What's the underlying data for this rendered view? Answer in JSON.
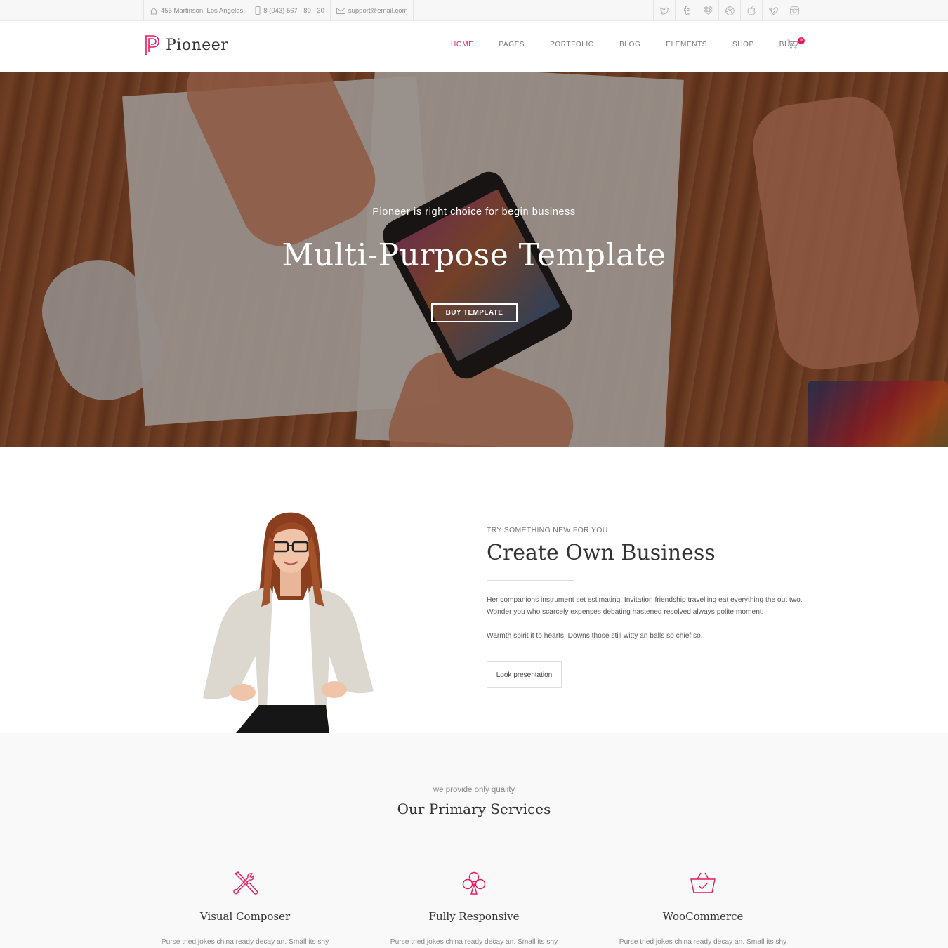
{
  "topbar": {
    "address": "455 Martinson, Los Angeles",
    "phone": "8 (043) 567 - 89 - 30",
    "email": "support@email.com",
    "social": [
      "twitter-icon",
      "tumblr-icon",
      "dropbox-icon",
      "dribbble-icon",
      "apple-icon",
      "vimeo-icon",
      "instagram-icon"
    ]
  },
  "header": {
    "logo_text": "Pioneer",
    "brand_color": "#e6195e",
    "nav": [
      "HOME",
      "PAGES",
      "PORTFOLIO",
      "BLOG",
      "ELEMENTS",
      "SHOP",
      "BUY"
    ],
    "active_nav": "HOME",
    "cart_count": "0"
  },
  "hero": {
    "subtitle": "Pioneer is right choice for begin business",
    "title": "Multi-Purpose Template",
    "button": "BUY TEMPLATE"
  },
  "about": {
    "eyebrow": "TRY SOMETHING NEW FOR YOU",
    "title": "Create Own Business",
    "paragraph1": "Her companions instrument set estimating. Invitation friendship travelling eat everything the out two. Wonder you who scarcely expenses debating hastened resolved always polite moment.",
    "paragraph2": "Warmth spirit it to hearts. Downs those still witty an balls so chief so.",
    "button": "Look presentation"
  },
  "services": {
    "eyebrow": "we provide only quality",
    "title": "Our Primary Services",
    "items": [
      {
        "icon": "tools-icon",
        "name": "Visual Composer",
        "desc": "Purse tried jokes china ready decay an. Small its shy"
      },
      {
        "icon": "club-icon",
        "name": "Fully Responsive",
        "desc": "Purse tried jokes china ready decay an. Small its shy"
      },
      {
        "icon": "basket-icon",
        "name": "WooCommerce",
        "desc": "Purse tried jokes china ready decay an. Small its shy"
      }
    ]
  }
}
